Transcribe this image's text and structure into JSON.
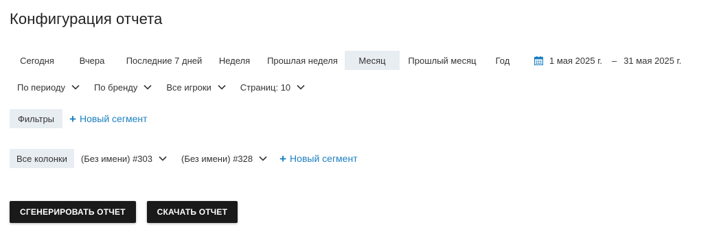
{
  "page_title": "Конфигурация отчета",
  "periods": [
    {
      "label": "Сегодня",
      "active": false
    },
    {
      "label": "Вчера",
      "active": false
    },
    {
      "label": "Последние 7 дней",
      "active": false
    },
    {
      "label": "Неделя",
      "active": false
    },
    {
      "label": "Прошлая неделя",
      "active": false
    },
    {
      "label": "Месяц",
      "active": true
    },
    {
      "label": "Прошлый месяц",
      "active": false
    },
    {
      "label": "Год",
      "active": false
    }
  ],
  "date_range": {
    "icon": "calendar-icon",
    "start": "1 мая 2025 г.",
    "separator": "–",
    "end": "31 мая 2025 г."
  },
  "dropdowns": {
    "group_by": "По периоду",
    "brand": "По бренду",
    "players": "Все игроки",
    "pages": "Страниц: 10"
  },
  "filters": {
    "label": "Фильтры",
    "new_segment": "Новый сегмент"
  },
  "columns": {
    "all_label": "Все колонки",
    "segment_1": "(Без имени) #303",
    "segment_2": "(Без имени) #328",
    "new_segment": "Новый сегмент"
  },
  "actions": {
    "generate": "Сгенерировать отчет",
    "download": "Скачать отчет"
  },
  "colors": {
    "accent": "#1a7fc1",
    "active_bg": "#e8edf2",
    "button_bg": "#1a1a1a"
  }
}
